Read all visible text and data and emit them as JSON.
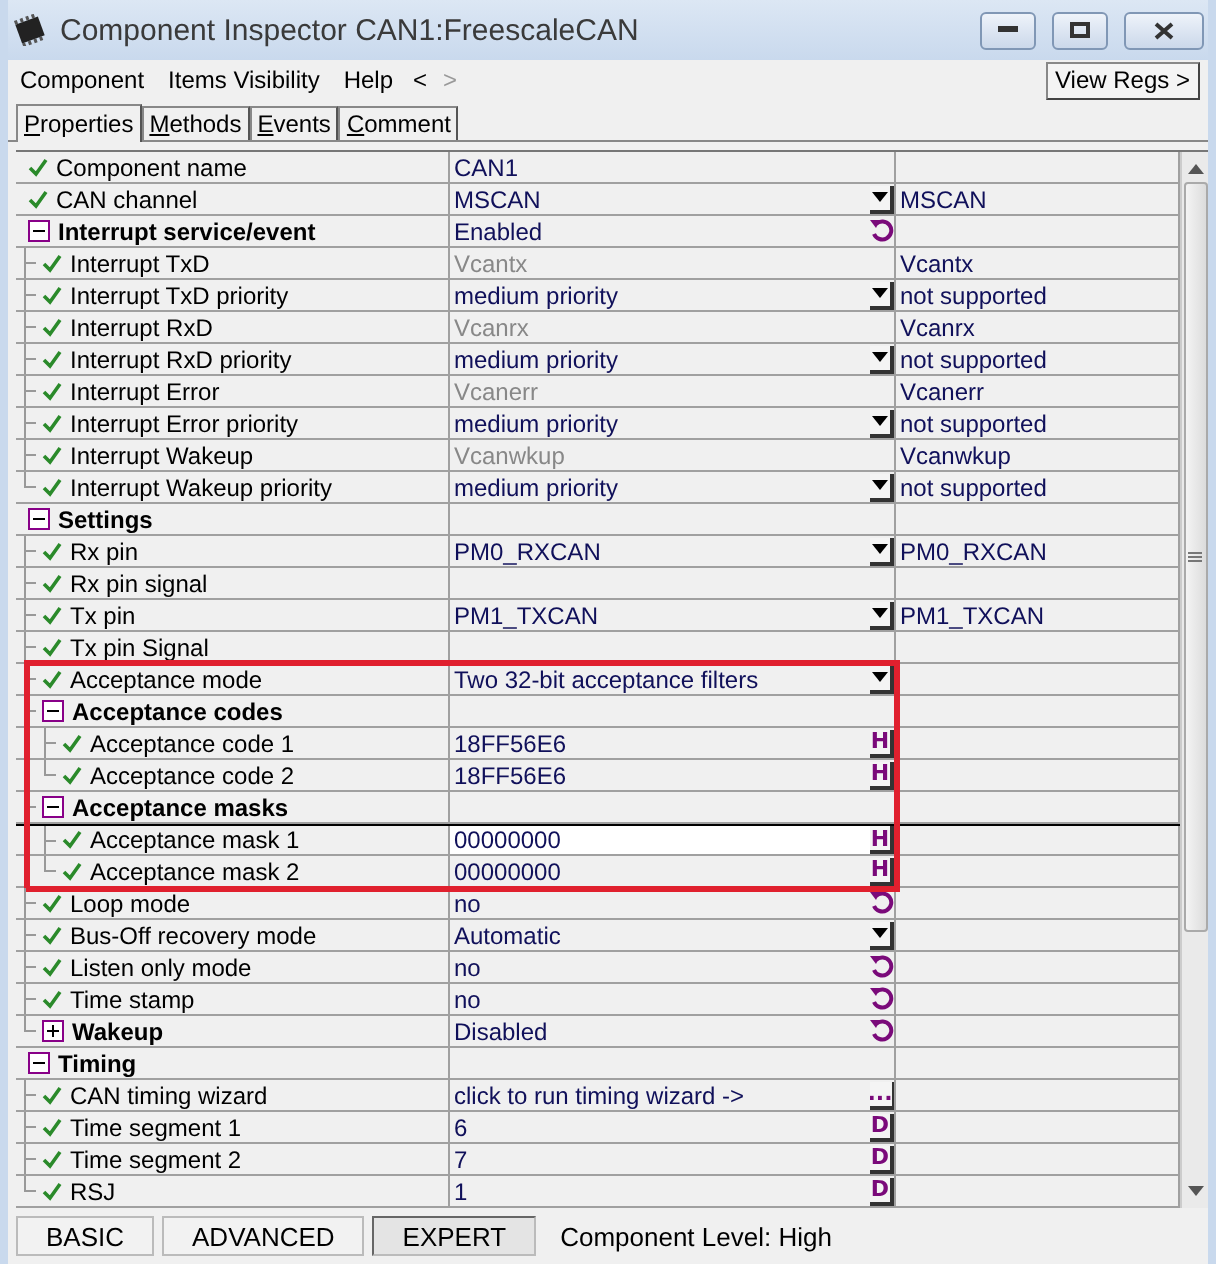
{
  "window": {
    "title": "Component Inspector CAN1:FreescaleCAN"
  },
  "menu": [
    "Component",
    "Items Visibility",
    "Help"
  ],
  "nav": [
    "<",
    ">"
  ],
  "view_regs": "View Regs >",
  "tabs": [
    {
      "label": "Properties",
      "selected": true
    },
    {
      "label": "Methods",
      "selected": false
    },
    {
      "label": "Events",
      "selected": false
    },
    {
      "label": "Comment",
      "selected": false
    }
  ],
  "rows": [
    {
      "kind": "item",
      "name": "Component name",
      "value": "CAN1",
      "valid": true,
      "selected": false
    },
    {
      "kind": "item",
      "name": "CAN channel",
      "value": "MSCAN",
      "button": {
        "kind": "dropdown"
      },
      "column_3": "MSCAN",
      "valid": true,
      "selected": false
    },
    {
      "kind": "group",
      "name": "Interrupt service/event",
      "value": "Enabled",
      "button": {
        "kind": "reset"
      },
      "expanded": true,
      "selected": false,
      "children": [
        {
          "kind": "item",
          "name": "Interrupt TxD",
          "value": "Vcantx",
          "value_disabled": true,
          "column_3": "Vcantx",
          "valid": true,
          "selected": false
        },
        {
          "kind": "item",
          "name": "Interrupt TxD priority",
          "value": "medium priority",
          "button": {
            "kind": "dropdown"
          },
          "column_3": "not supported",
          "valid": true,
          "selected": false
        },
        {
          "kind": "item",
          "name": "Interrupt RxD",
          "value": "Vcanrx",
          "value_disabled": true,
          "column_3": "Vcanrx",
          "valid": true,
          "selected": false
        },
        {
          "kind": "item",
          "name": "Interrupt RxD priority",
          "value": "medium priority",
          "button": {
            "kind": "dropdown"
          },
          "column_3": "not supported",
          "valid": true,
          "selected": false
        },
        {
          "kind": "item",
          "name": "Interrupt Error",
          "value": "Vcanerr",
          "value_disabled": true,
          "column_3": "Vcanerr",
          "valid": true,
          "selected": false
        },
        {
          "kind": "item",
          "name": "Interrupt Error priority",
          "value": "medium priority",
          "button": {
            "kind": "dropdown"
          },
          "column_3": "not supported",
          "valid": true,
          "selected": false
        },
        {
          "kind": "item",
          "name": "Interrupt Wakeup",
          "value": "Vcanwkup",
          "value_disabled": true,
          "column_3": "Vcanwkup",
          "valid": true,
          "selected": false
        },
        {
          "kind": "item",
          "name": "Interrupt Wakeup priority",
          "value": "medium priority",
          "button": {
            "kind": "dropdown"
          },
          "column_3": "not supported",
          "valid": true,
          "selected": false
        }
      ]
    },
    {
      "kind": "group",
      "name": "Settings",
      "expanded": true,
      "selected": false,
      "children": [
        {
          "kind": "item",
          "name": "Rx pin",
          "value": "PM0_RXCAN",
          "button": {
            "kind": "dropdown"
          },
          "column_3": "PM0_RXCAN",
          "valid": true,
          "selected": false
        },
        {
          "kind": "item",
          "name": "Rx pin signal",
          "valid": true,
          "selected": false
        },
        {
          "kind": "item",
          "name": "Tx pin",
          "value": "PM1_TXCAN",
          "button": {
            "kind": "dropdown"
          },
          "column_3": "PM1_TXCAN",
          "valid": true,
          "selected": false
        },
        {
          "kind": "item",
          "name": "Tx pin Signal",
          "valid": true,
          "selected": false
        },
        {
          "kind": "item",
          "name": "Acceptance mode",
          "value": "Two 32-bit acceptance filters",
          "button": {
            "kind": "dropdown"
          },
          "valid": true,
          "selected": false,
          "annotated": true
        },
        {
          "kind": "group",
          "name": "Acceptance codes",
          "expanded": true,
          "selected": false,
          "annotated": true,
          "children": [
            {
              "kind": "item",
              "name": "Acceptance code 1",
              "value": "18FF56E6",
              "button": {
                "kind": "text",
                "label": "H"
              },
              "valid": true,
              "selected": false,
              "annotated": true
            },
            {
              "kind": "item",
              "name": "Acceptance code 2",
              "value": "18FF56E6",
              "button": {
                "kind": "text",
                "label": "H"
              },
              "valid": true,
              "selected": false,
              "annotated": true
            }
          ]
        },
        {
          "kind": "group",
          "name": "Acceptance masks",
          "expanded": true,
          "selected": false,
          "annotated": true,
          "children": [
            {
              "kind": "item",
              "name": "Acceptance mask 1",
              "value": "00000000",
              "button": {
                "kind": "text",
                "label": "H"
              },
              "valid": true,
              "selected": true,
              "annotated": true
            },
            {
              "kind": "item",
              "name": "Acceptance mask 2",
              "value": "00000000",
              "button": {
                "kind": "text",
                "label": "H"
              },
              "valid": true,
              "selected": false,
              "annotated": true
            }
          ]
        },
        {
          "kind": "item",
          "name": "Loop mode",
          "value": "no",
          "button": {
            "kind": "reset"
          },
          "valid": true,
          "selected": false
        },
        {
          "kind": "item",
          "name": "Bus-Off recovery mode",
          "value": "Automatic",
          "button": {
            "kind": "dropdown"
          },
          "valid": true,
          "selected": false
        },
        {
          "kind": "item",
          "name": "Listen only mode",
          "value": "no",
          "button": {
            "kind": "reset"
          },
          "valid": true,
          "selected": false
        },
        {
          "kind": "item",
          "name": "Time stamp",
          "value": "no",
          "button": {
            "kind": "reset"
          },
          "valid": true,
          "selected": false
        },
        {
          "kind": "group",
          "name": "Wakeup",
          "value": "Disabled",
          "button": {
            "kind": "reset"
          },
          "expanded": false,
          "selected": false
        }
      ]
    },
    {
      "kind": "group",
      "name": "Timing",
      "expanded": true,
      "selected": false,
      "children": [
        {
          "kind": "item",
          "name": "CAN timing wizard",
          "value": "click to run timing wizard ->",
          "button": {
            "kind": "text",
            "label": "..."
          },
          "valid": true,
          "selected": false
        },
        {
          "kind": "item",
          "name": "Time segment 1",
          "value": "6",
          "button": {
            "kind": "text",
            "label": "D"
          },
          "valid": true,
          "selected": false
        },
        {
          "kind": "item",
          "name": "Time segment 2",
          "value": "7",
          "button": {
            "kind": "text",
            "label": "D"
          },
          "valid": true,
          "selected": false
        },
        {
          "kind": "item",
          "name": "RSJ",
          "value": "1",
          "button": {
            "kind": "text",
            "label": "D"
          },
          "valid": true,
          "selected": false
        }
      ]
    }
  ],
  "levels": [
    {
      "label": "BASIC",
      "selected": false
    },
    {
      "label": "ADVANCED",
      "selected": false
    },
    {
      "label": "EXPERT",
      "selected": true
    }
  ],
  "status": "Component Level: High"
}
